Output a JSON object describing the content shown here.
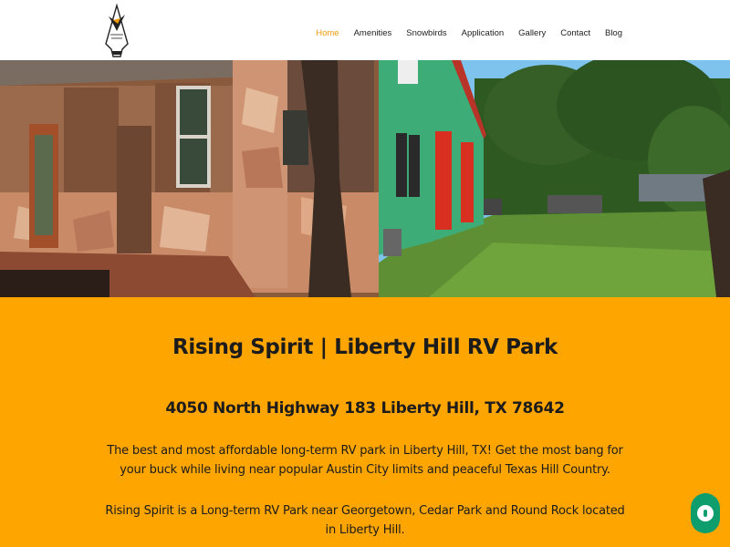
{
  "logo": {
    "text": "Rising Spirit RV Park",
    "icon": "arrowhead-eagle-logo"
  },
  "nav": {
    "items": [
      {
        "label": "Home",
        "active": true
      },
      {
        "label": "Amenities",
        "active": false
      },
      {
        "label": "Snowbirds",
        "active": false
      },
      {
        "label": "Application",
        "active": false
      },
      {
        "label": "Gallery",
        "active": false
      },
      {
        "label": "Contact",
        "active": false
      },
      {
        "label": "Blog",
        "active": false
      }
    ]
  },
  "colors": {
    "accent": "#f29a0c",
    "band": "#ffa500",
    "chat": "#0e9e6e"
  },
  "main": {
    "title": "Rising Spirit | Liberty Hill RV Park",
    "address": "4050 North Highway 183 Liberty Hill, TX 78642",
    "paragraph1": "The best and most affordable long-term RV park in Liberty Hill, TX! Get the most bang for your buck while living near popular Austin City limits and peaceful Texas Hill Country.",
    "paragraph2": "Rising Spirit is a Long-term RV Park near Georgetown, Cedar Park and Round Rock located in Liberty Hill."
  },
  "chat": {
    "icon": "chat-bubble-icon"
  }
}
